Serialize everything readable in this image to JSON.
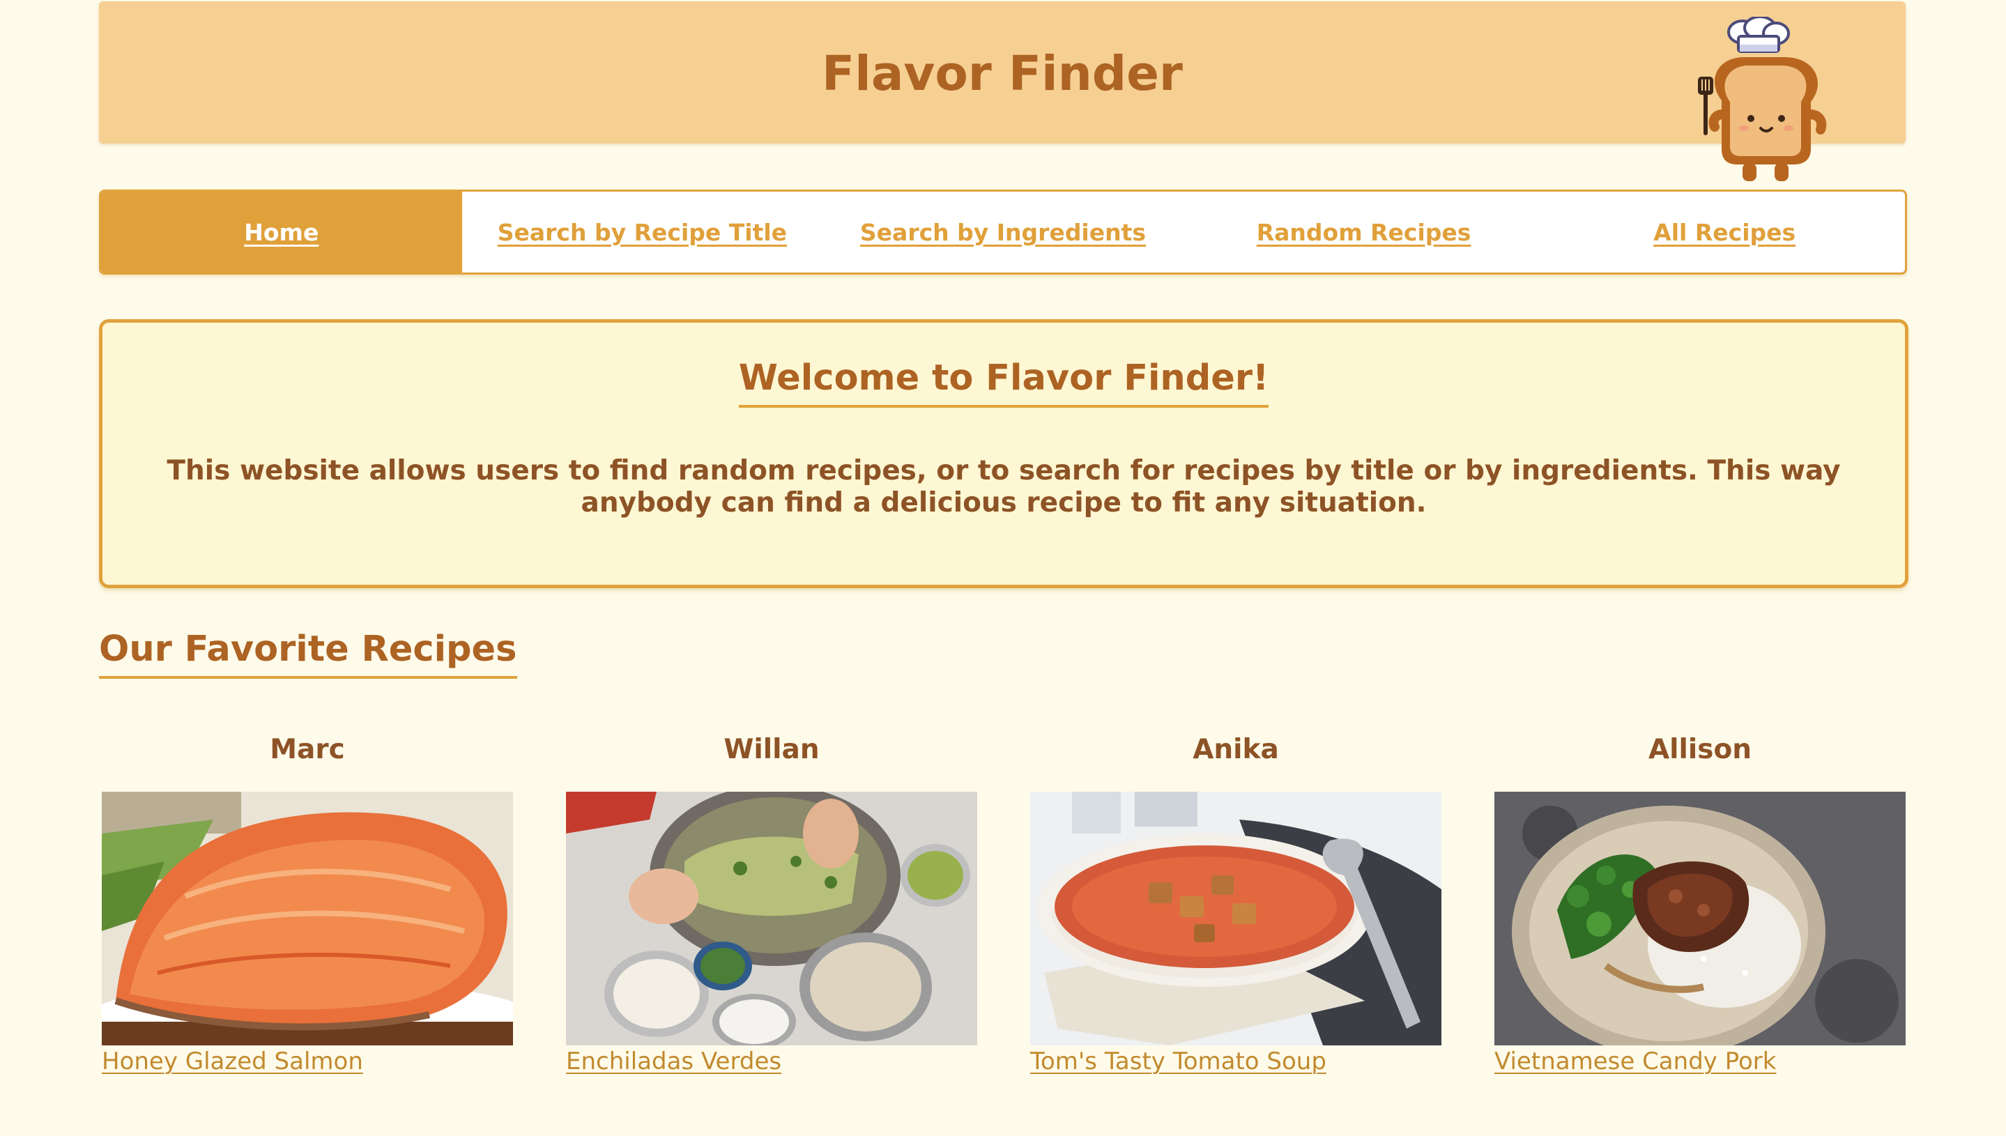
{
  "header": {
    "title": "Flavor Finder",
    "mascot_icon": "chef-toast-mascot-icon",
    "background_color": "#f6cf93",
    "title_color": "#ad6323"
  },
  "nav": {
    "items": [
      {
        "label": "Home",
        "active": true
      },
      {
        "label": "Search by Recipe Title",
        "active": false
      },
      {
        "label": "Search by Ingredients",
        "active": false
      },
      {
        "label": "Random Recipes",
        "active": false
      },
      {
        "label": "All Recipes",
        "active": false
      }
    ],
    "accent_color": "#e0a03a"
  },
  "welcome": {
    "title": "Welcome to Flavor Finder!",
    "text": "This website allows users to find random recipes, or to search for recipes by title or by ingredients. This way anybody can find a delicious recipe to fit any situation."
  },
  "favorites": {
    "heading": "Our Favorite Recipes",
    "cards": [
      {
        "name": "Marc",
        "recipe": "Honey Glazed Salmon",
        "image": "salmon-photo"
      },
      {
        "name": "Willan",
        "recipe": "Enchiladas Verdes",
        "image": "enchiladas-photo"
      },
      {
        "name": "Anika",
        "recipe": "Tom's Tasty Tomato Soup",
        "image": "tomato-soup-photo"
      },
      {
        "name": "Allison",
        "recipe": "Vietnamese Candy Pork",
        "image": "candy-pork-photo"
      }
    ]
  },
  "colors": {
    "page_background": "#fefbea",
    "welcome_background": "#fef7d3",
    "heading_text": "#ad6323",
    "body_text": "#8d5326",
    "link_text": "#c28a2e"
  }
}
